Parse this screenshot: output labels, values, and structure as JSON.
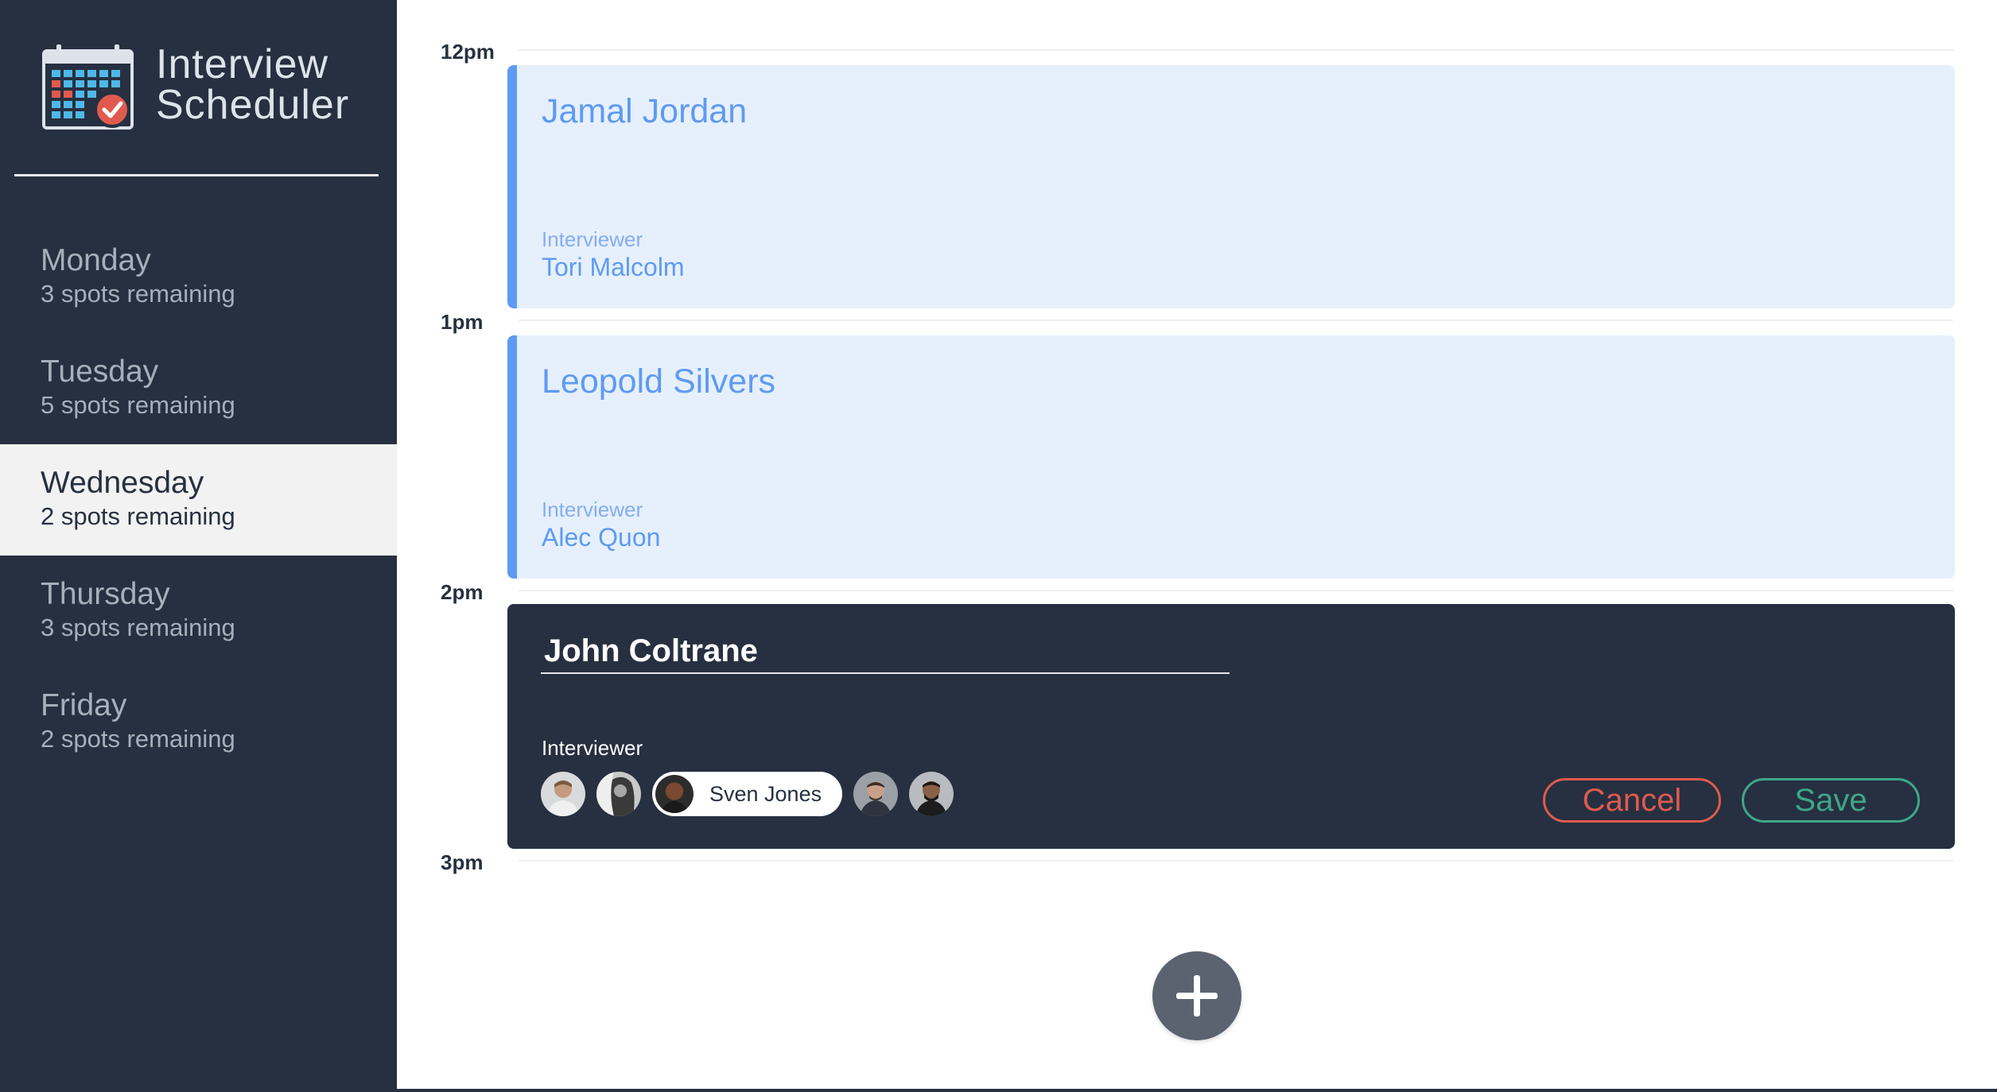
{
  "app": {
    "title_line1": "Interview",
    "title_line2": "Scheduler"
  },
  "sidebar": {
    "days": [
      {
        "name": "Monday",
        "spots": "3 spots remaining",
        "selected": false
      },
      {
        "name": "Tuesday",
        "spots": "5 spots remaining",
        "selected": false
      },
      {
        "name": "Wednesday",
        "spots": "2 spots remaining",
        "selected": true
      },
      {
        "name": "Thursday",
        "spots": "3 spots remaining",
        "selected": false
      },
      {
        "name": "Friday",
        "spots": "2 spots remaining",
        "selected": false
      }
    ]
  },
  "schedule": {
    "times": [
      "12pm",
      "1pm",
      "2pm",
      "3pm"
    ],
    "appointments": [
      {
        "student": "Jamal Jordan",
        "interviewer_label": "Interviewer",
        "interviewer": "Tori Malcolm"
      },
      {
        "student": "Leopold Silvers",
        "interviewer_label": "Interviewer",
        "interviewer": "Alec Quon"
      }
    ],
    "editing": {
      "student_value": "John Coltrane",
      "interviewer_label": "Interviewer",
      "selected_interviewer": "Sven Jones",
      "cancel_label": "Cancel",
      "save_label": "Save"
    }
  },
  "colors": {
    "sidebar_bg": "#263040",
    "appointment_bg": "#e6f0fc",
    "appointment_accent": "#5f9af2",
    "cancel": "#e05a4f",
    "save": "#3fa68a"
  },
  "icons": {
    "logo": "calendar-check-icon",
    "add": "plus-icon"
  }
}
